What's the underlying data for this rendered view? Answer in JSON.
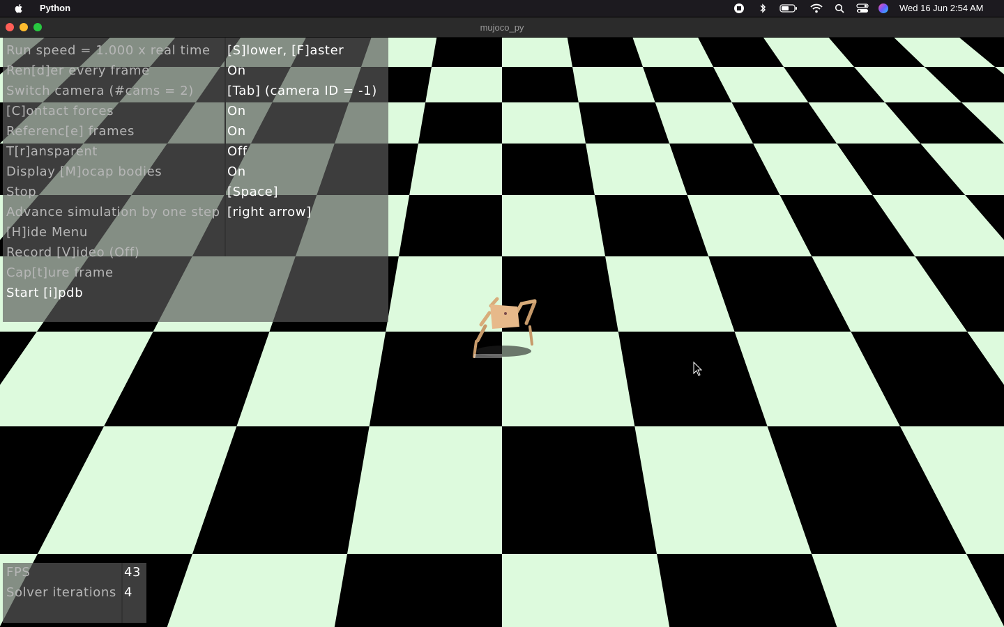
{
  "menubar": {
    "app_name": "Python",
    "clock": "Wed 16 Jun  2:54 AM",
    "icons": [
      "apple-icon",
      "screen-record-icon",
      "bluetooth-icon",
      "battery-icon",
      "wifi-icon",
      "spotlight-search-icon",
      "control-center-icon",
      "siri-icon"
    ]
  },
  "window": {
    "title": "mujoco_py"
  },
  "scene": {
    "floor_colors": {
      "light": "#ddfadd",
      "dark": "#000000"
    }
  },
  "menu": {
    "rows": [
      {
        "label": "Run speed = 1.000 x real time",
        "value": "[S]lower, [F]aster"
      },
      {
        "label": "Ren[d]er every frame",
        "value": "On"
      },
      {
        "label": "Switch camera (#cams = 2)",
        "value": "[Tab] (camera ID = -1)"
      },
      {
        "label": "[C]ontact forces",
        "value": "On"
      },
      {
        "label": "Referenc[e] frames",
        "value": "On"
      },
      {
        "label": "T[r]ansparent",
        "value": "Off"
      },
      {
        "label": "Display [M]ocap bodies",
        "value": "On"
      },
      {
        "label": "Stop",
        "value": "[Space]"
      },
      {
        "label": "Advance simulation by one step",
        "value": "[right arrow]"
      },
      {
        "label": "[H]ide Menu",
        "value": ""
      },
      {
        "label": "Record [V]ideo (Off)",
        "value": ""
      },
      {
        "label": "Cap[t]ure frame",
        "value": ""
      },
      {
        "label": "Start [i]pdb",
        "value": ""
      }
    ]
  },
  "stats": {
    "rows": [
      {
        "label": "FPS",
        "value": "43"
      },
      {
        "label": "Solver iterations",
        "value": "4"
      }
    ]
  }
}
